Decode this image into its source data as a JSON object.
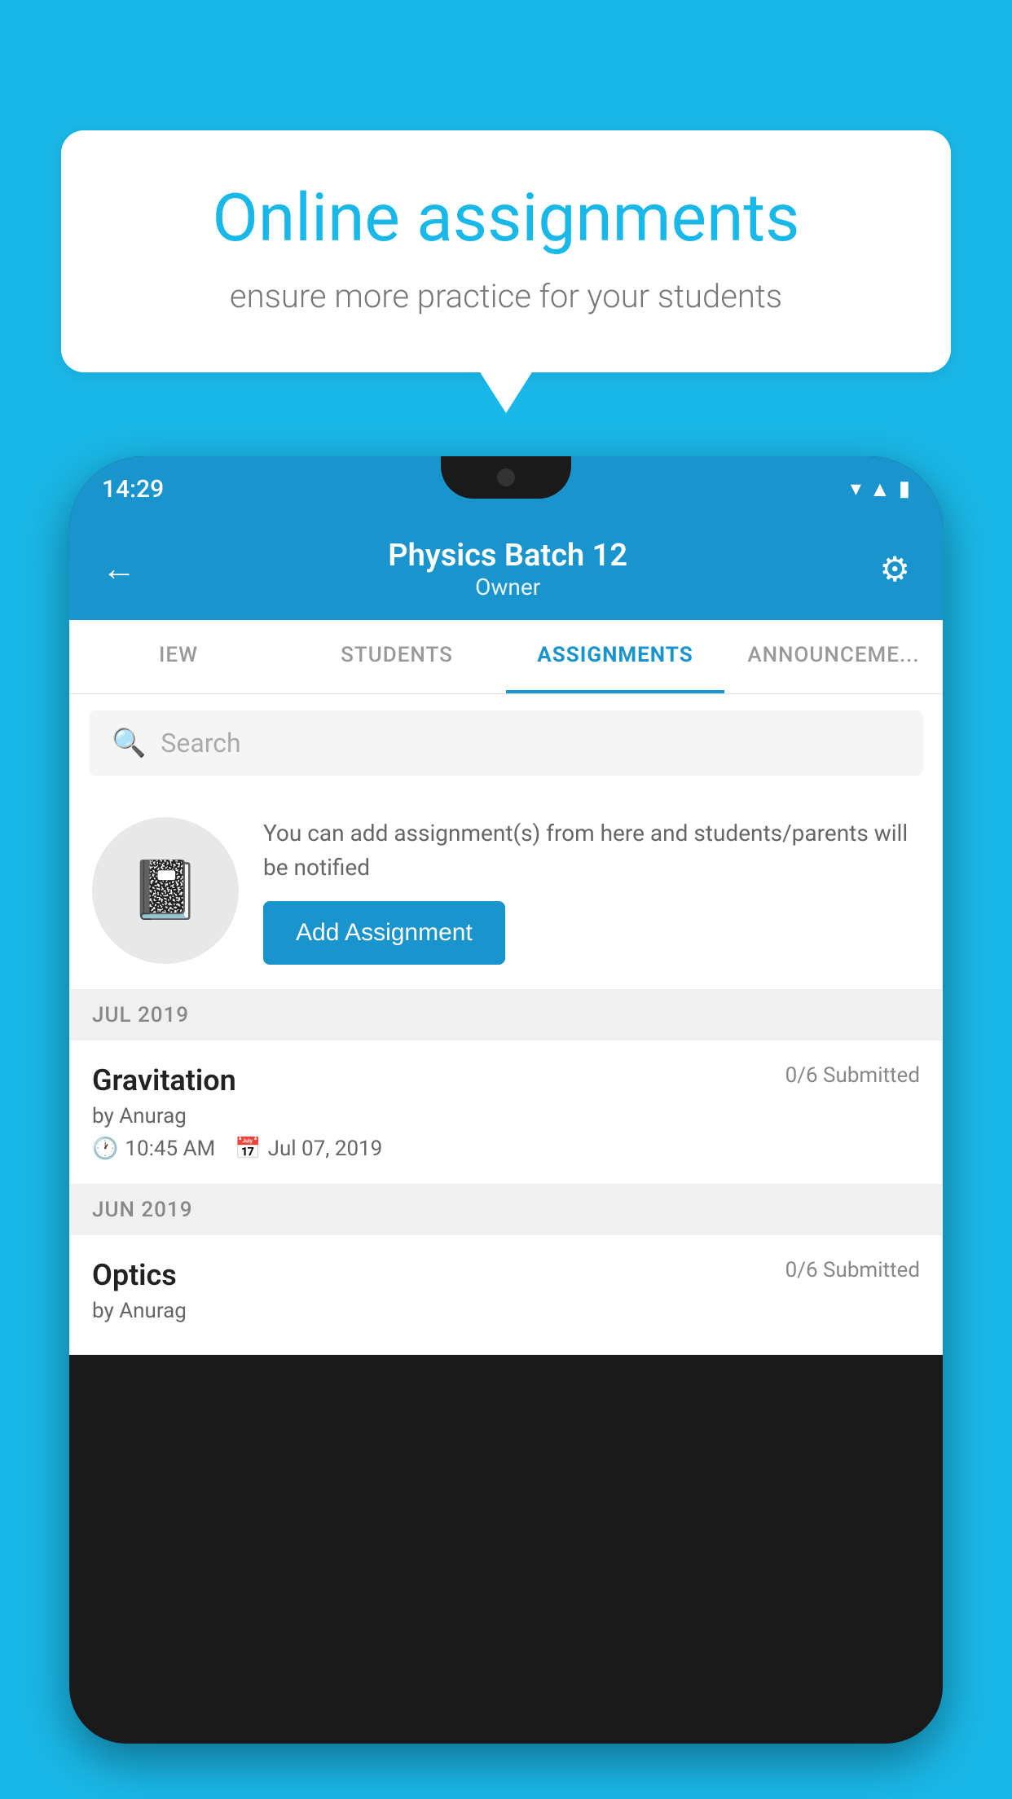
{
  "background_color": "#1ab8e8",
  "speech_bubble": {
    "title": "Online assignments",
    "subtitle": "ensure more practice for your students"
  },
  "phone": {
    "status_bar": {
      "time": "14:29"
    },
    "header": {
      "title": "Physics Batch 12",
      "subtitle": "Owner",
      "back_label": "←",
      "settings_label": "⚙"
    },
    "tabs": [
      {
        "label": "IEW",
        "active": false
      },
      {
        "label": "STUDENTS",
        "active": false
      },
      {
        "label": "ASSIGNMENTS",
        "active": true
      },
      {
        "label": "ANNOUNCEMENTS",
        "active": false
      }
    ],
    "search": {
      "placeholder": "Search"
    },
    "promo": {
      "description": "You can add assignment(s) from here and students/parents will be notified",
      "button_label": "Add Assignment"
    },
    "assignments": [
      {
        "month": "JUL 2019",
        "items": [
          {
            "name": "Gravitation",
            "submitted": "0/6 Submitted",
            "author": "by Anurag",
            "time": "10:45 AM",
            "date": "Jul 07, 2019"
          }
        ]
      },
      {
        "month": "JUN 2019",
        "items": [
          {
            "name": "Optics",
            "submitted": "0/6 Submitted",
            "author": "by Anurag"
          }
        ]
      }
    ]
  }
}
